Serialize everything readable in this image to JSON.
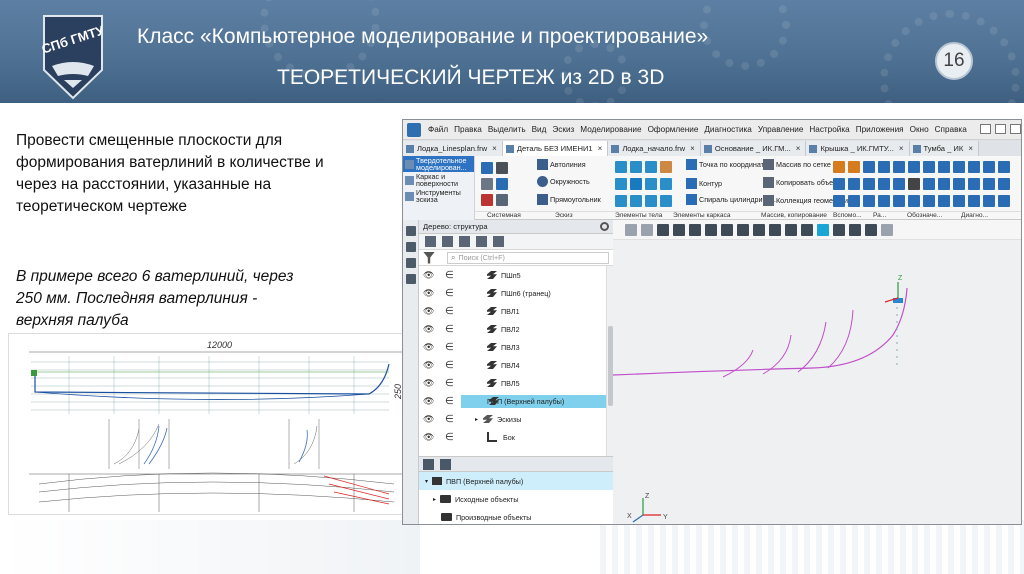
{
  "slide": {
    "title_line1": "Класс «Компьютерное моделирование и проектирование»",
    "title_line2": "ТЕОРЕТИЧЕСКИЙ ЧЕРТЕЖ из 2D в 3D",
    "page_number": "16",
    "logo_text": "СПб ГМТУ",
    "body_text": "Провести   смещенные плоскости для формирования ватерлиний в количестве и через на расстоянии, указанные на теоретическом чертеже",
    "example_text": "В примере всего 6 ватерлиний, через 250 мм. Последняя ватерлиния - верхняя палуба"
  },
  "drawing": {
    "length_label": "12000",
    "height_label": "250"
  },
  "app": {
    "menu": [
      "Файл",
      "Правка",
      "Выделить",
      "Вид",
      "Эскиз",
      "Моделирование",
      "Оформление",
      "Диагностика",
      "Управление",
      "Настройка",
      "Приложения",
      "Окно",
      "Справка"
    ],
    "tabs": [
      {
        "label": "Лодка_Linesplan.frw",
        "active": false
      },
      {
        "label": "Деталь БЕЗ ИМЕНИ1",
        "active": true
      },
      {
        "label": "Лодка_начало.frw",
        "active": false
      },
      {
        "label": "Основание _ ИК.ГМ...",
        "active": false
      },
      {
        "label": "Крышка _ ИК.ГМТУ...",
        "active": false
      },
      {
        "label": "Тумба _ ИК",
        "active": false
      }
    ],
    "modes": [
      "Твердотельное моделирован...",
      "Каркас и поверхности",
      "Инструменты эскиза"
    ],
    "ribbon_buttons": {
      "autoline": "Автолиния",
      "circle": "Окружность",
      "rectangle": "Прямоугольник",
      "point_coords": "Точка по координатам",
      "contour": "Контур",
      "spiral": "Спираль цилиндричес...",
      "array_grid": "Массив по сетке",
      "copy_objects": "Копировать объекты",
      "geometry_collection": "Коллекция геометрии"
    },
    "group_labels": [
      "Системная",
      "Эскиз",
      "Элементы тела",
      "Элементы каркаса",
      "Массив, копирование",
      "Вспомо...",
      "Ра...",
      "Обозначе...",
      "Диагно..."
    ],
    "tree": {
      "header": "Дерево: структура",
      "search_placeholder": "Поиск (Ctrl+F)",
      "items": [
        {
          "label": "ПШп5",
          "selected": false
        },
        {
          "label": "ПШп6 (транец)",
          "selected": false
        },
        {
          "label": "ПВЛ1",
          "selected": false
        },
        {
          "label": "ПВЛ2",
          "selected": false
        },
        {
          "label": "ПВЛ3",
          "selected": false
        },
        {
          "label": "ПВЛ4",
          "selected": false
        },
        {
          "label": "ПВЛ5",
          "selected": false
        },
        {
          "label": "ПВП (Верхней палубы)",
          "selected": true
        },
        {
          "label": "Эскизы",
          "selected": false
        },
        {
          "label": "Бок",
          "selected": false
        }
      ]
    },
    "tree2": {
      "items": [
        "ПВП (Верхней палубы)",
        "Исходные объекты",
        "Производные объекты"
      ]
    },
    "axes": {
      "x": "X",
      "y": "Y",
      "z": "Z"
    }
  },
  "colors": {
    "header_blue": "#4f7294",
    "selection_cyan": "#7fd0ec",
    "mode_active": "#2e73c2",
    "curve_pink": "#c04fc9"
  }
}
